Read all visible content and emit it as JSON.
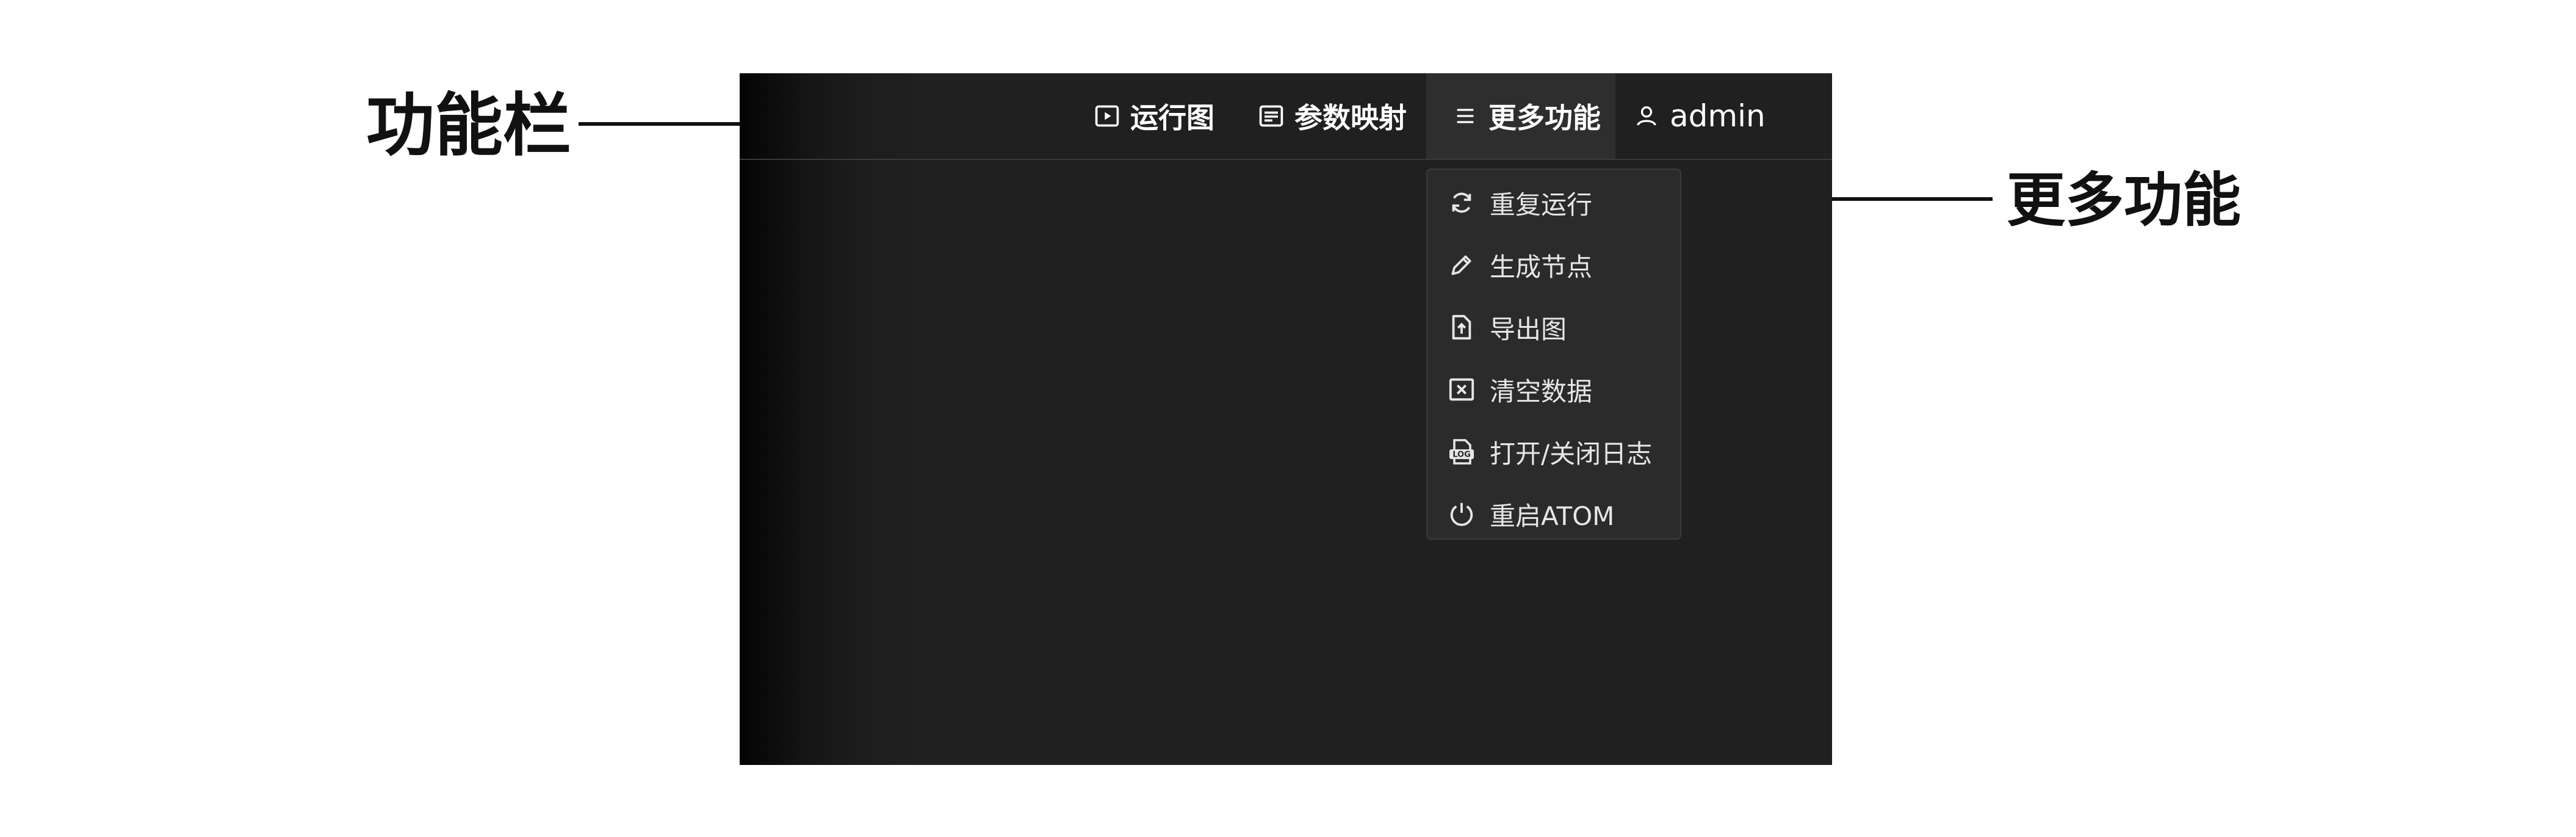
{
  "callouts": {
    "toolbar_label": "功能栏",
    "more_label": "更多功能"
  },
  "nav": {
    "items": [
      {
        "label": "运行图",
        "icon": "play-box-icon"
      },
      {
        "label": "参数映射",
        "icon": "list-box-icon"
      },
      {
        "label": "更多功能",
        "icon": "hamburger-menu-icon",
        "active": true
      },
      {
        "label": "admin",
        "icon": "user-icon"
      }
    ]
  },
  "menu": {
    "items": [
      {
        "label": "重复运行",
        "icon": "refresh-icon"
      },
      {
        "label": "生成节点",
        "icon": "pencil-icon"
      },
      {
        "label": "导出图",
        "icon": "file-upload-icon"
      },
      {
        "label": "清空数据",
        "icon": "clear-box-icon"
      },
      {
        "label": "打开/关闭日志",
        "icon": "log-icon"
      },
      {
        "label": "重启ATOM",
        "icon": "power-icon"
      }
    ]
  },
  "colors": {
    "window_bg": "#202020",
    "nav_active_bg": "#2e2e2e",
    "menu_bg": "#2b2b2b",
    "text_primary": "#ffffff"
  }
}
